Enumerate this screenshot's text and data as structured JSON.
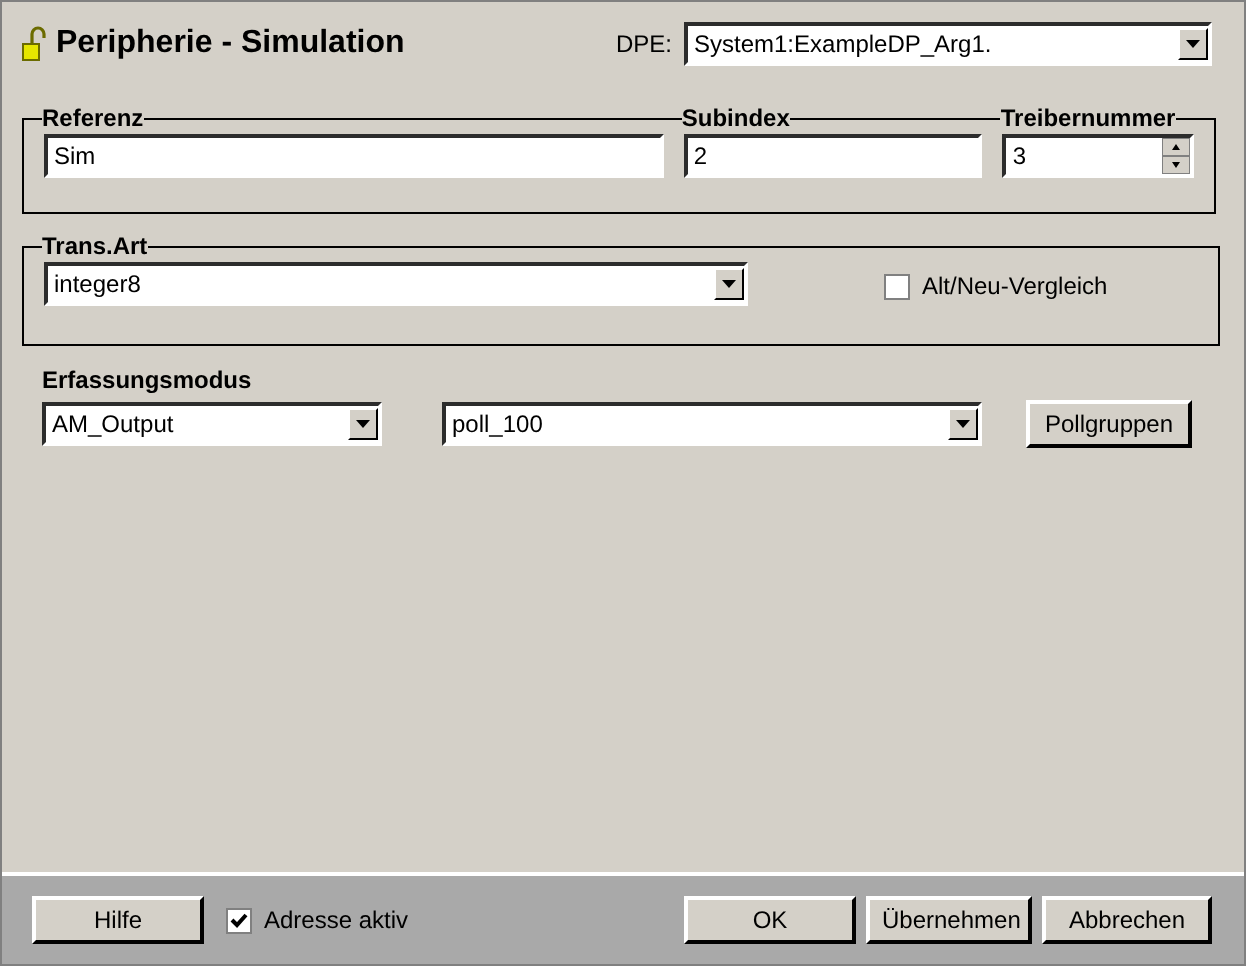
{
  "window": {
    "title": "Peripherie - Simulation"
  },
  "dpe": {
    "label": "DPE:",
    "value": "System1:ExampleDP_Arg1."
  },
  "address_group": {
    "fields": [
      {
        "kind": "text",
        "label": "Referenz",
        "value": "Sim"
      },
      {
        "kind": "text",
        "label": "Subindex",
        "value": "2"
      },
      {
        "kind": "spin",
        "label": "Treibernummer",
        "value": "3"
      }
    ]
  },
  "trans_group": {
    "label": "Trans.Art",
    "value": "integer8",
    "checkbox": {
      "label": "Alt/Neu-Vergleich",
      "checked": false
    }
  },
  "mode": {
    "label": "Erfassungsmodus",
    "mode_value": "AM_Output",
    "poll_value": "poll_100",
    "button": "Pollgruppen"
  },
  "footer": {
    "help_button": "Hilfe",
    "active_checkbox": {
      "label": "Adresse aktiv",
      "checked": true
    },
    "buttons": [
      "OK",
      "Übernehmen",
      "Abbrechen"
    ]
  }
}
